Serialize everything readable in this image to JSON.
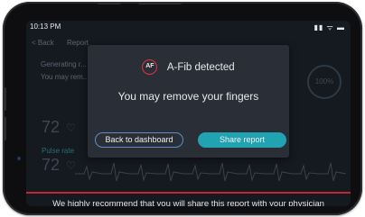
{
  "status_bar": {
    "time": "10:13 PM",
    "icons": "▮▮ ᯤ ▬"
  },
  "background": {
    "back_label": "< Back",
    "report_label": "Report",
    "generating_text": "Generating r...",
    "may_remove_text": "You may rem...",
    "ring_text": "100%",
    "heart_rate_1": "72",
    "pulse_label": "Pulse rate",
    "heart_rate_2": "72",
    "heart_icon": "♡"
  },
  "modal": {
    "badge": "AF",
    "title": "A-Fib detected",
    "subtitle": "You may remove your fingers",
    "back_button": "Back to dashboard",
    "share_button": "Share report"
  },
  "bottom_message": "We highly recommend that you will share this report with your physician",
  "colors": {
    "accent_red": "#c4252f",
    "share_button": "#22a3b2",
    "back_button_border": "#5a8fc8"
  }
}
